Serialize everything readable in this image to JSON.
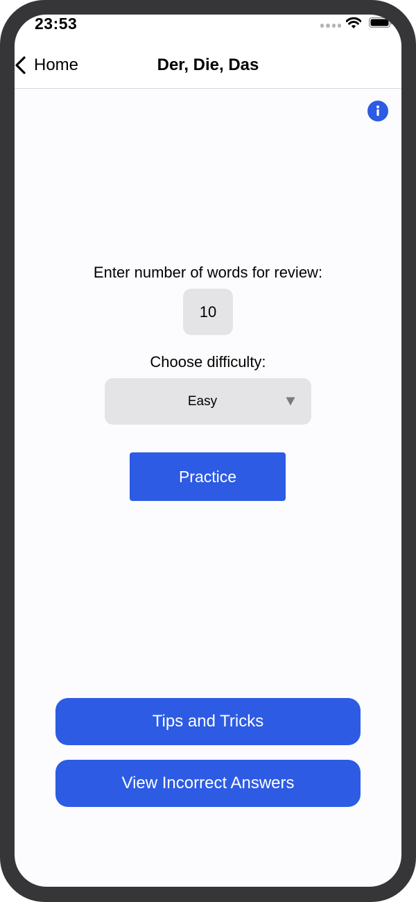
{
  "status_bar": {
    "time": "23:53",
    "icons": [
      "signal-dots-icon",
      "wifi-icon",
      "battery-icon"
    ]
  },
  "nav": {
    "back_label": "Home",
    "back_icon": "chevron-left-icon",
    "title": "Der, Die, Das"
  },
  "info": {
    "icon": "info-icon",
    "glyph": "i"
  },
  "form": {
    "words_label": "Enter number of words for review:",
    "words_value": "10",
    "difficulty_label": "Choose difficulty:",
    "difficulty_value": "Easy",
    "difficulty_icon": "dropdown-triangle-icon"
  },
  "buttons": {
    "practice": "Practice",
    "tips": "Tips and Tricks",
    "incorrect": "View Incorrect Answers"
  },
  "colors": {
    "accent": "#2d5be3",
    "field_background": "#e4e4e6",
    "device_frame": "#363538",
    "screen_background": "#fcfcfe"
  }
}
